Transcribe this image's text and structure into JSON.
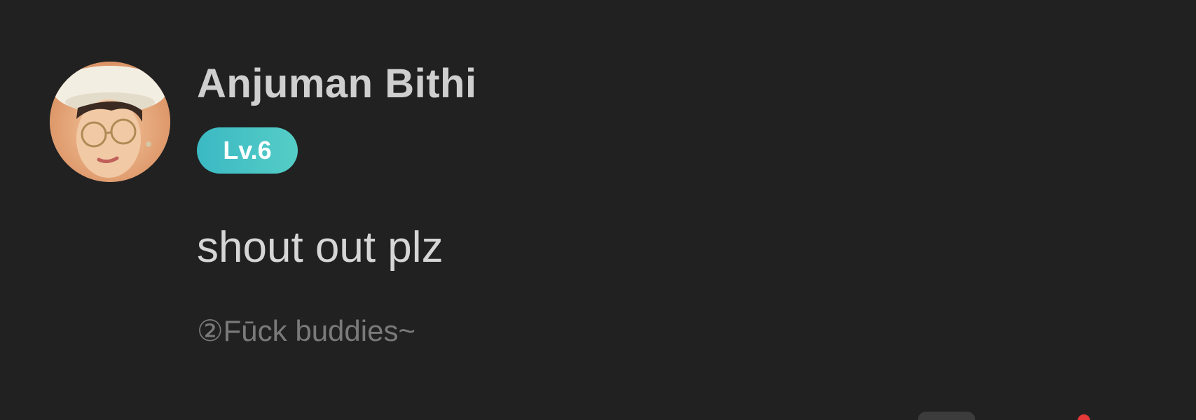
{
  "comment": {
    "author": {
      "name": "Anjuman Bithi",
      "level_badge": "Lv.6",
      "avatar_icon": "user-avatar-photo"
    },
    "text": "shout out plz",
    "community_tag": "②Fūck buddies~"
  },
  "footer": {
    "reply_icon": "comment-icon",
    "notification_icon": "notification-dot-icon"
  },
  "colors": {
    "background": "#212121",
    "author_name": "#cfcfcf",
    "badge_start": "#3bb9c4",
    "badge_end": "#55cdc6",
    "comment_text": "#d6d6d6",
    "tag_text": "#7a7a7a",
    "notification_dot": "#e53939"
  }
}
